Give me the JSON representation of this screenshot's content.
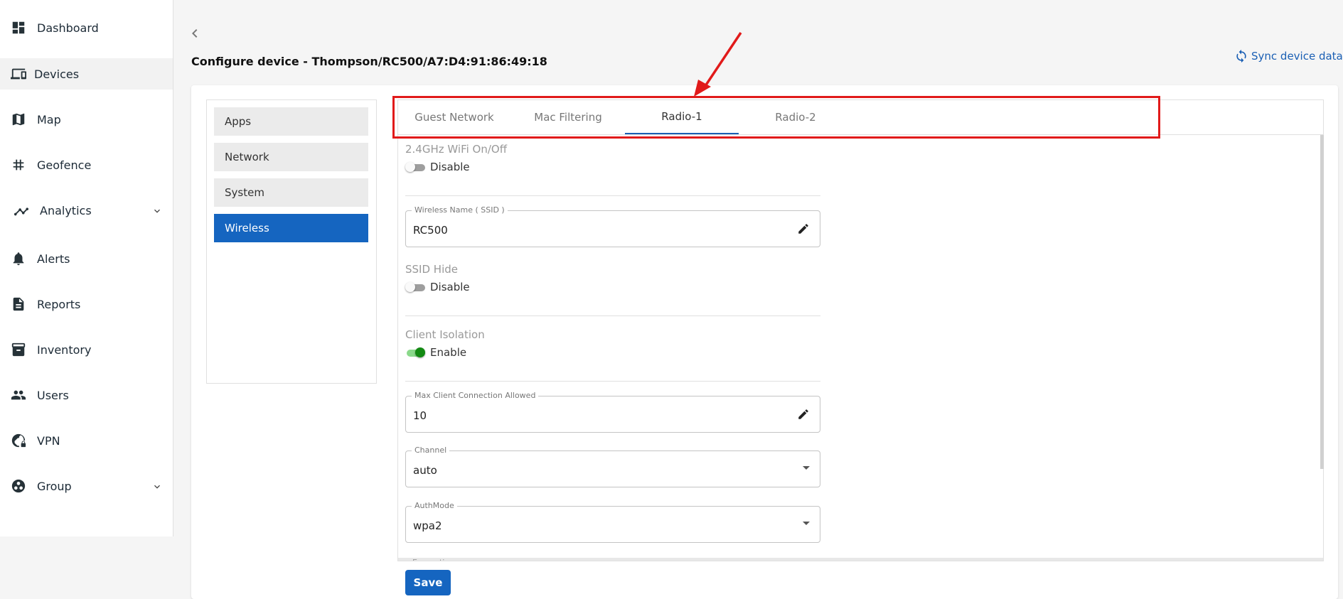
{
  "sidebar": {
    "items": [
      {
        "label": "Dashboard",
        "icon": "dashboard-icon"
      },
      {
        "label": "Devices",
        "icon": "devices-icon"
      },
      {
        "label": "Map",
        "icon": "map-icon"
      },
      {
        "label": "Geofence",
        "icon": "geofence-icon"
      },
      {
        "label": "Analytics",
        "icon": "analytics-icon"
      },
      {
        "label": "Alerts",
        "icon": "bell-icon"
      },
      {
        "label": "Reports",
        "icon": "reports-icon"
      },
      {
        "label": "Inventory",
        "icon": "inventory-icon"
      },
      {
        "label": "Users",
        "icon": "users-icon"
      },
      {
        "label": "VPN",
        "icon": "vpn-icon"
      },
      {
        "label": "Group",
        "icon": "group-icon"
      }
    ]
  },
  "header": {
    "title": "Configure device - Thompson/RC500/A7:D4:91:86:49:18",
    "sync_label": "Sync device data"
  },
  "config_menu": {
    "items": [
      "Apps",
      "Network",
      "System",
      "Wireless"
    ],
    "selected": "Wireless"
  },
  "tabs": {
    "items": [
      "Guest Network",
      "Mac Filtering",
      "Radio-1",
      "Radio-2"
    ],
    "active": "Radio-1"
  },
  "form": {
    "wifi_onoff": {
      "label": "2.4GHz WiFi On/Off",
      "state": "Disable"
    },
    "ssid": {
      "label": "Wireless Name ( SSID )",
      "value": "RC500"
    },
    "ssid_hide": {
      "label": "SSID Hide",
      "state": "Disable"
    },
    "client_isolation": {
      "label": "Client Isolation",
      "state": "Enable"
    },
    "max_clients": {
      "label": "Max Client Connection Allowed",
      "value": "10"
    },
    "channel": {
      "label": "Channel",
      "value": "auto"
    },
    "authmode": {
      "label": "AuthMode",
      "value": "wpa2"
    },
    "encryption": {
      "label": "Encryption"
    },
    "save_label": "Save"
  },
  "colors": {
    "accent": "#1565c0",
    "highlight": "#e11a1a",
    "toggle_on": "#138a13"
  }
}
